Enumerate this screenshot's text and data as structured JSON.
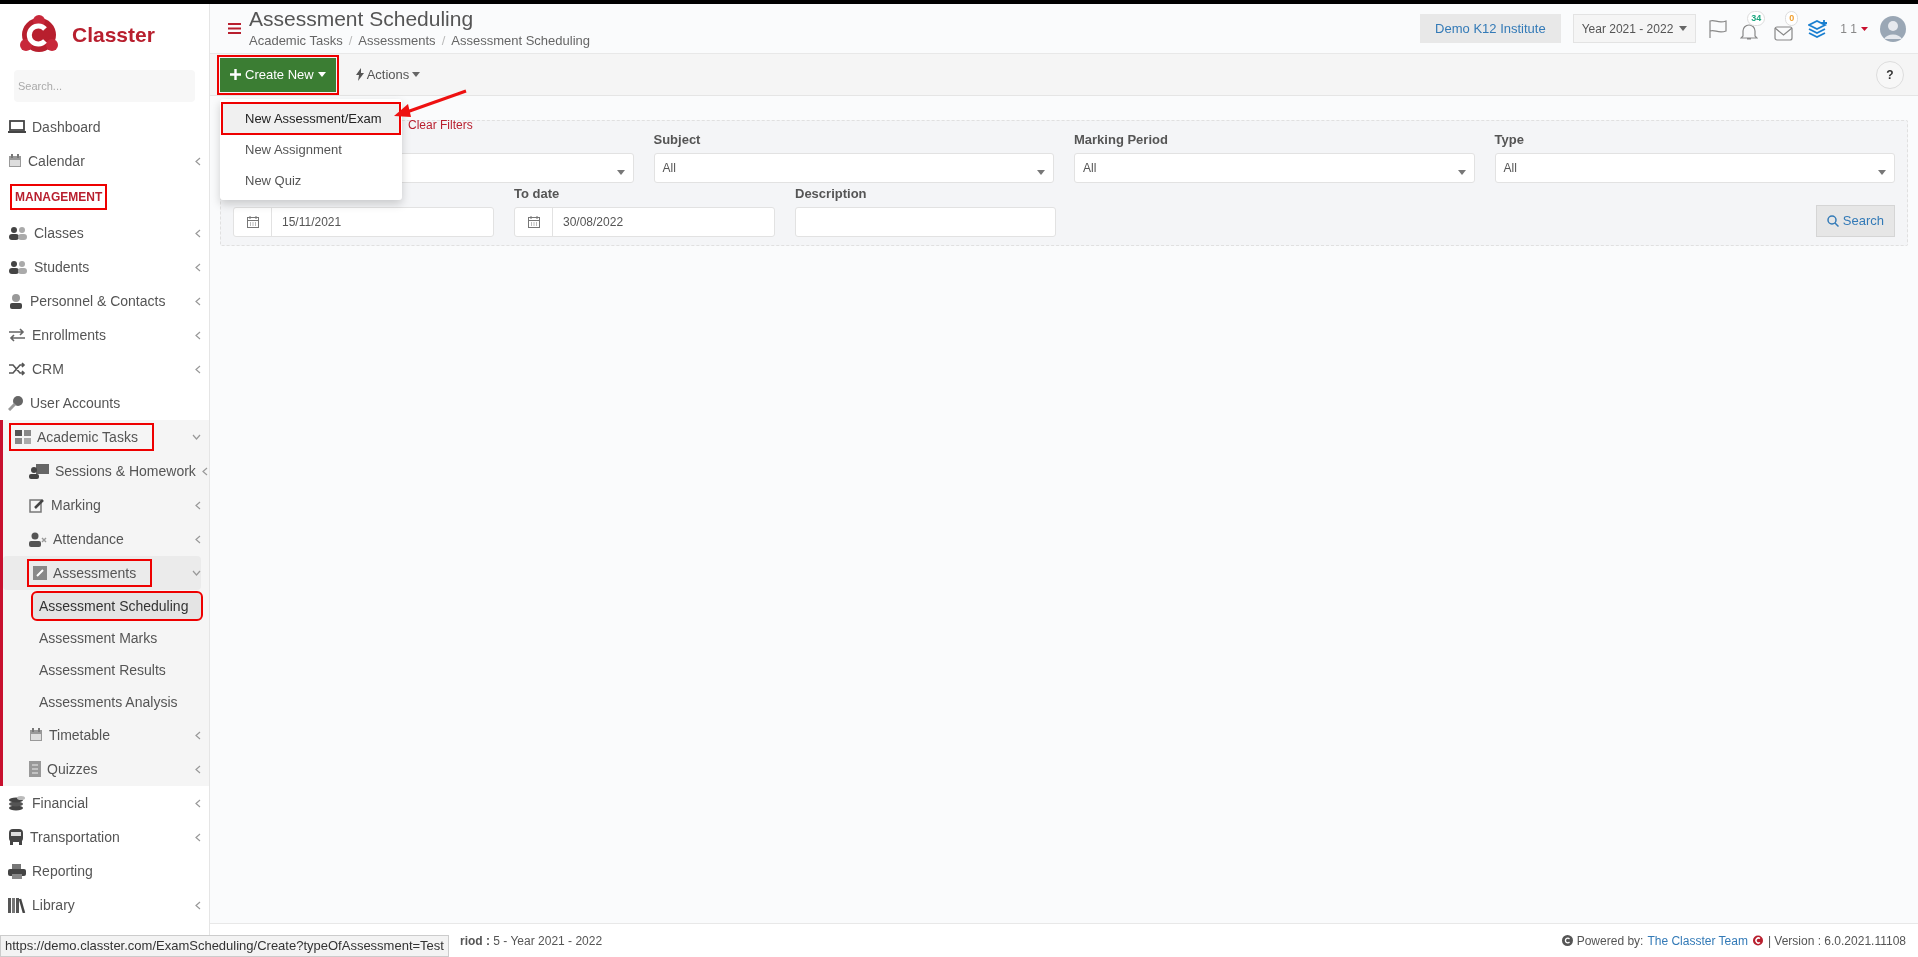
{
  "brand": {
    "name": "Classter"
  },
  "sidebar": {
    "search_placeholder": "Search...",
    "items": [
      {
        "kind": "item",
        "label": "Dashboard",
        "submenu": false,
        "expanded": false,
        "selected": false,
        "highlighted": false
      },
      {
        "kind": "item",
        "label": "Calendar",
        "submenu": true,
        "expanded": false,
        "selected": false,
        "highlighted": false
      },
      {
        "kind": "section",
        "label": "MANAGEMENT",
        "highlighted": true
      },
      {
        "kind": "item",
        "label": "Classes",
        "submenu": true,
        "expanded": false,
        "selected": false,
        "highlighted": false
      },
      {
        "kind": "item",
        "label": "Students",
        "submenu": true,
        "expanded": false,
        "selected": false,
        "highlighted": false
      },
      {
        "kind": "item",
        "label": "Personnel & Contacts",
        "submenu": true,
        "expanded": false,
        "selected": false,
        "highlighted": false
      },
      {
        "kind": "item",
        "label": "Enrollments",
        "submenu": true,
        "expanded": false,
        "selected": false,
        "highlighted": false
      },
      {
        "kind": "item",
        "label": "CRM",
        "submenu": true,
        "expanded": false,
        "selected": false,
        "highlighted": false
      },
      {
        "kind": "item",
        "label": "User Accounts",
        "submenu": false,
        "expanded": false,
        "selected": false,
        "highlighted": false
      },
      {
        "kind": "item",
        "label": "Academic Tasks",
        "submenu": true,
        "expanded": true,
        "selected": false,
        "highlighted": true,
        "children": [
          {
            "kind": "item",
            "label": "Sessions & Homework",
            "submenu": true,
            "expanded": false,
            "selected": false,
            "highlighted": false
          },
          {
            "kind": "item",
            "label": "Marking",
            "submenu": true,
            "expanded": false,
            "selected": false,
            "highlighted": false
          },
          {
            "kind": "item",
            "label": "Attendance",
            "submenu": true,
            "expanded": false,
            "selected": false,
            "highlighted": false
          },
          {
            "kind": "item",
            "label": "Assessments",
            "submenu": true,
            "expanded": true,
            "selected": false,
            "highlighted": true,
            "children": [
              {
                "kind": "item",
                "label": "Assessment Scheduling",
                "submenu": false,
                "expanded": false,
                "selected": true,
                "highlighted": true
              },
              {
                "kind": "item",
                "label": "Assessment Marks",
                "submenu": false,
                "expanded": false,
                "selected": false,
                "highlighted": false
              },
              {
                "kind": "item",
                "label": "Assessment Results",
                "submenu": false,
                "expanded": false,
                "selected": false,
                "highlighted": false
              },
              {
                "kind": "item",
                "label": "Assessments Analysis",
                "submenu": false,
                "expanded": false,
                "selected": false,
                "highlighted": false
              }
            ]
          },
          {
            "kind": "item",
            "label": "Timetable",
            "submenu": true,
            "expanded": false,
            "selected": false,
            "highlighted": false
          },
          {
            "kind": "item",
            "label": "Quizzes",
            "submenu": true,
            "expanded": false,
            "selected": false,
            "highlighted": false
          }
        ]
      },
      {
        "kind": "item",
        "label": "Financial",
        "submenu": true,
        "expanded": false,
        "selected": false,
        "highlighted": false
      },
      {
        "kind": "item",
        "label": "Transportation",
        "submenu": true,
        "expanded": false,
        "selected": false,
        "highlighted": false
      },
      {
        "kind": "item",
        "label": "Reporting",
        "submenu": false,
        "expanded": false,
        "selected": false,
        "highlighted": false
      },
      {
        "kind": "item",
        "label": "Library",
        "submenu": true,
        "expanded": false,
        "selected": false,
        "highlighted": false
      }
    ]
  },
  "header": {
    "title": "Assessment Scheduling",
    "breadcrumb": [
      "Academic Tasks",
      "Assessments",
      "Assessment Scheduling"
    ],
    "breadcrumb_separator": "/",
    "institute": "Demo K12 Institute",
    "year": "Year 2021 - 2022",
    "notifications": "34",
    "messages": "0",
    "user": "1 1"
  },
  "toolbar": {
    "create_button": {
      "label": "Create New",
      "highlighted": true
    },
    "actions_button": {
      "label": "Actions"
    },
    "help": "?"
  },
  "create_menu": [
    {
      "label": "New Assessment/Exam",
      "selected": true,
      "highlighted": true
    },
    {
      "label": "New Assignment",
      "selected": false,
      "highlighted": false
    },
    {
      "label": "New Quiz",
      "selected": false,
      "highlighted": false
    }
  ],
  "filters": {
    "clear_link": "Clear Filters",
    "row_1": [
      {
        "kind": "select"
      },
      {
        "kind": "select",
        "label": "Subject",
        "value": "All"
      },
      {
        "kind": "select",
        "label": "Marking Period",
        "value": "All"
      },
      {
        "kind": "select",
        "label": "Type",
        "value": "All"
      }
    ],
    "row_2": [
      {
        "kind": "date",
        "value": "15/11/2021"
      },
      {
        "kind": "date",
        "label": "To date",
        "value": "30/08/2022"
      },
      {
        "kind": "text",
        "label": "Description"
      }
    ],
    "search_button": "Search"
  },
  "status_url": "https://demo.classter.com/ExamScheduling/Create?typeOfAssessment=Test",
  "footer": {
    "period": "**riod :** 5 - Year 2021 - 2022",
    "powered_by": "Powered by:",
    "team": "The Classter Team",
    "version": "| Version : 6.0.2021.11108"
  }
}
